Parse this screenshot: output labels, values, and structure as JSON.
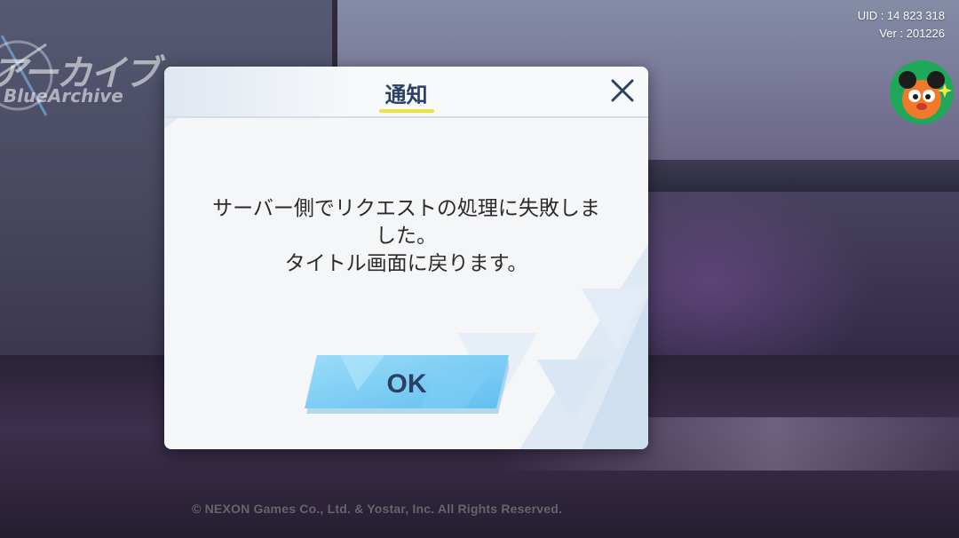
{
  "logo": {
    "japanese": "アーカイブ",
    "english": "BlueArchive"
  },
  "build_info": {
    "uid": "UID : 14 823 318",
    "version": "Ver : 201226"
  },
  "dialog": {
    "title": "通知",
    "message_lines": [
      "サーバー側でリクエストの処理に失敗しま",
      "した。",
      "タイトル画面に戻ります。"
    ],
    "ok_label": "OK"
  },
  "footer": {
    "copyright": "© NEXON Games Co., Ltd. & Yostar, Inc. All Rights Reserved."
  },
  "colors": {
    "accent_blue": "#79c9f2",
    "title_underline": "#f2e03a",
    "title_text": "#2c4064"
  }
}
